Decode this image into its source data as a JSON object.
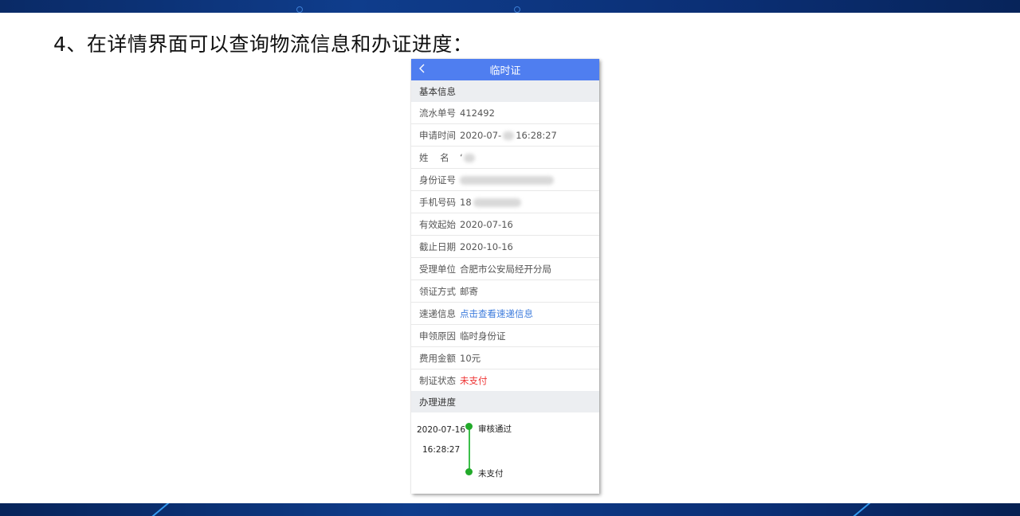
{
  "slide": {
    "title": "4、在详情界面可以查询物流信息和办证进度："
  },
  "app": {
    "header_title": "临时证",
    "back_icon": "chevron-left-icon",
    "header_color": "#4f7ef0"
  },
  "basic_info": {
    "section_title": "基本信息",
    "rows": [
      {
        "label": "流水单号",
        "value": "412492"
      },
      {
        "label": "申请时间",
        "value_prefix": "2020-07-",
        "value_suffix": "16:28:27"
      },
      {
        "label": "姓    名",
        "value": "‘"
      },
      {
        "label": "身份证号",
        "value": ""
      },
      {
        "label": "手机号码",
        "value": "18"
      },
      {
        "label": "有效起始",
        "value": "2020-07-16"
      },
      {
        "label": "截止日期",
        "value": "2020-10-16"
      },
      {
        "label": "受理单位",
        "value": "合肥市公安局经开分局"
      },
      {
        "label": "领证方式",
        "value": "邮寄"
      },
      {
        "label": "速递信息",
        "value": "点击查看速递信息",
        "link_color": "#3c7bdc"
      },
      {
        "label": "申领原因",
        "value": "临时身份证"
      },
      {
        "label": "费用金额",
        "value": "10元"
      },
      {
        "label": "制证状态",
        "value": "未支付",
        "alert_color": "#ee3333"
      }
    ]
  },
  "progress": {
    "section_title": "办理进度",
    "entries": [
      {
        "date": "2020-07-16",
        "time": "16:28:27",
        "status": "审核通过"
      },
      {
        "status": "未支付"
      }
    ],
    "node_color": "#22aa2a"
  }
}
